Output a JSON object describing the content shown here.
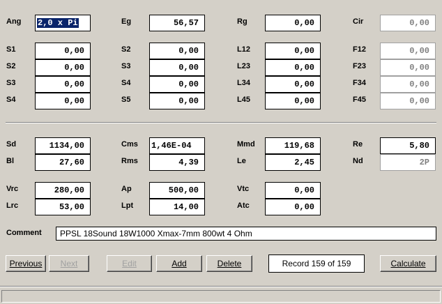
{
  "group1": [
    {
      "label": "Ang",
      "value": "2,0 x Pi",
      "state": "selected"
    },
    {
      "label": "Eg",
      "value": "56,57"
    },
    {
      "label": "Rg",
      "value": "0,00"
    },
    {
      "label": "Cir",
      "value": "0,00",
      "state": "readonly"
    }
  ],
  "segments": {
    "col1": [
      {
        "label": "S1",
        "value": "0,00"
      },
      {
        "label": "S2",
        "value": "0,00"
      },
      {
        "label": "S3",
        "value": "0,00"
      },
      {
        "label": "S4",
        "value": "0,00"
      }
    ],
    "col2": [
      {
        "label": "S2",
        "value": "0,00"
      },
      {
        "label": "S3",
        "value": "0,00"
      },
      {
        "label": "S4",
        "value": "0,00"
      },
      {
        "label": "S5",
        "value": "0,00"
      }
    ],
    "col3": [
      {
        "label": "L12",
        "value": "0,00"
      },
      {
        "label": "L23",
        "value": "0,00"
      },
      {
        "label": "L34",
        "value": "0,00"
      },
      {
        "label": "L45",
        "value": "0,00"
      }
    ],
    "col4": [
      {
        "label": "F12",
        "value": "0,00"
      },
      {
        "label": "F23",
        "value": "0,00"
      },
      {
        "label": "F34",
        "value": "0,00"
      },
      {
        "label": "F45",
        "value": "0,00"
      }
    ]
  },
  "params": [
    {
      "label": "Sd",
      "value": "1134,00"
    },
    {
      "label": "Cms",
      "value": "1,46E-04"
    },
    {
      "label": "Mmd",
      "value": "119,68"
    },
    {
      "label": "Re",
      "value": "5,80"
    },
    {
      "label": "Bl",
      "value": "27,60"
    },
    {
      "label": "Rms",
      "value": "4,39"
    },
    {
      "label": "Le",
      "value": "2,45"
    },
    {
      "label": "Nd",
      "value": "2P"
    }
  ],
  "vent": [
    {
      "label": "Vrc",
      "value": "280,00"
    },
    {
      "label": "Ap",
      "value": "500,00"
    },
    {
      "label": "Vtc",
      "value": "0,00"
    },
    {
      "label": "Lrc",
      "value": "53,00"
    },
    {
      "label": "Lpt",
      "value": "14,00"
    },
    {
      "label": "Atc",
      "value": "0,00"
    }
  ],
  "comment": {
    "label": "Comment",
    "value": "PPSL  18Sound 18W1000 Xmax-7mm 800wt 4 Ohm"
  },
  "buttons": {
    "previous": "Previous",
    "next": "Next",
    "edit": "Edit",
    "add": "Add",
    "delete": "Delete",
    "calculate": "Calculate"
  },
  "record": "Record 159 of 159"
}
